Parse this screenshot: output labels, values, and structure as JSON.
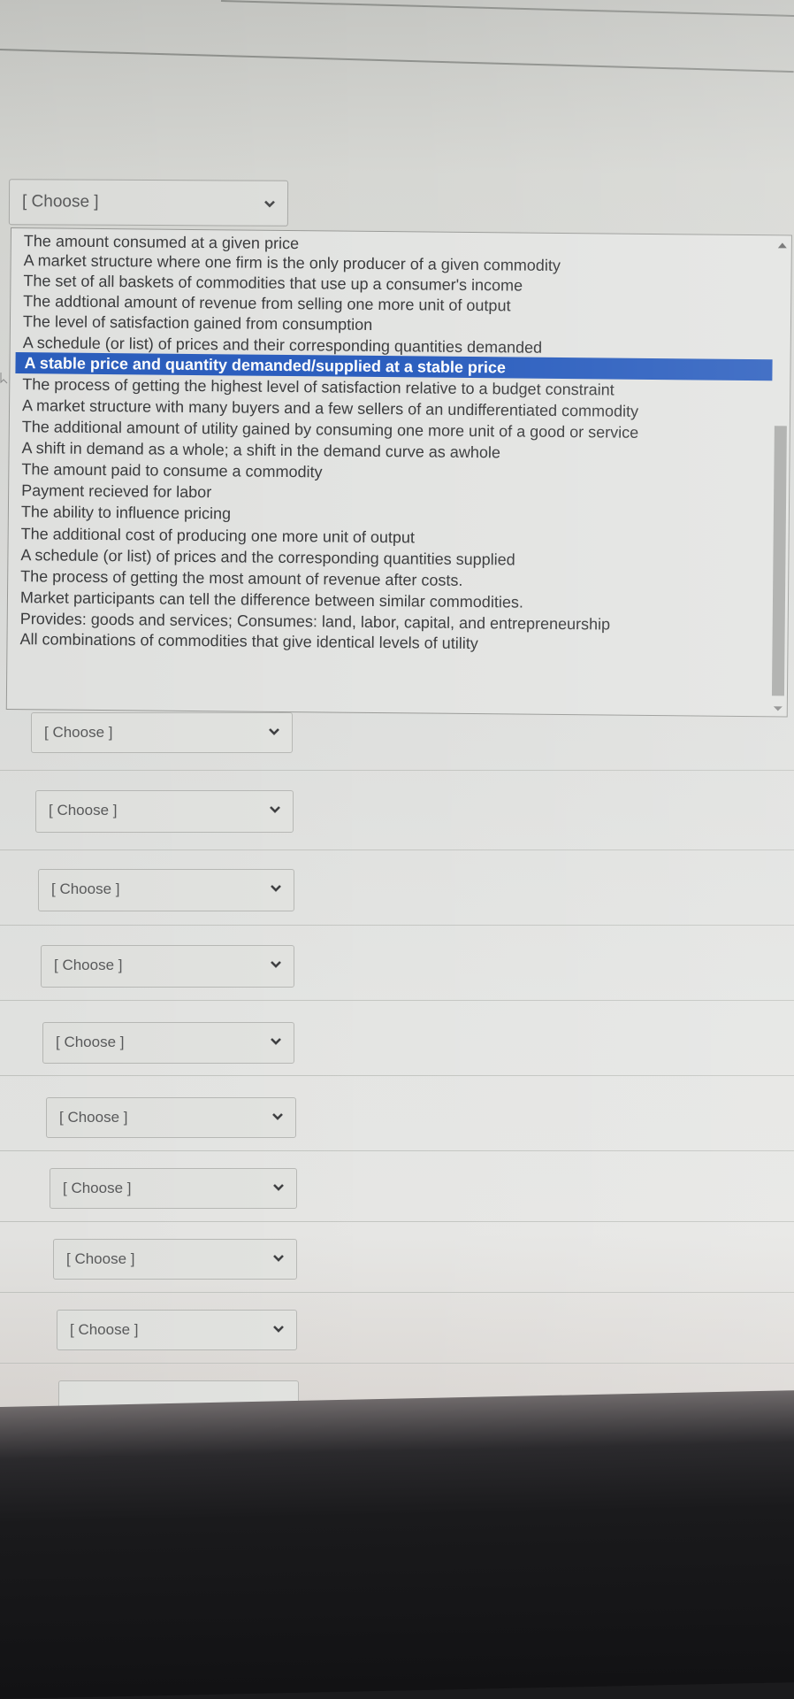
{
  "open_select": {
    "selected_label": "[ Choose ]",
    "options": [
      "The amount consumed at a given price",
      "A market structure where one firm is the only producer of a given commodity",
      "The set of all baskets of commodities that use up a consumer's income",
      "The addtional amount of revenue from selling one more unit of output",
      "The level of satisfaction gained from consumption",
      "A schedule (or list) of prices and their corresponding quantities demanded",
      "A stable price and quantity demanded/supplied at a stable price",
      "The process of getting the highest level of satisfaction relative to a budget constraint",
      "A market structure with many buyers and a few sellers of an undifferentiated commodity",
      "The additional amount of utility gained by consuming one more unit of a good or service",
      "A shift in demand as a whole; a shift in the demand curve as awhole",
      "The amount paid to consume a commodity",
      "Payment recieved for labor",
      "The ability to influence pricing",
      "The additional cost of producing one more unit of output",
      "A schedule (or list) of prices and the corresponding quantities supplied",
      "The process of getting the most amount of revenue after costs.",
      "Market participants can tell the difference between similar commodities.",
      "Provides: goods and services; Consumes: land, labor, capital, and entrepreneurship",
      "All combinations of commodities that give identical levels of utility"
    ],
    "highlighted_index": 6
  },
  "other_selects": [
    {
      "label": "[ Choose ]"
    },
    {
      "label": "[ Choose ]"
    },
    {
      "label": "[ Choose ]"
    },
    {
      "label": "[ Choose ]"
    },
    {
      "label": "[ Choose ]"
    },
    {
      "label": "[ Choose ]"
    },
    {
      "label": "[ Choose ]"
    },
    {
      "label": "[ Choose ]"
    },
    {
      "label": "[ Choose ]"
    }
  ],
  "colors": {
    "highlight": "#2c5fbf",
    "option_text": "#3b3c3e",
    "placeholder_text": "#5a5b5c"
  }
}
